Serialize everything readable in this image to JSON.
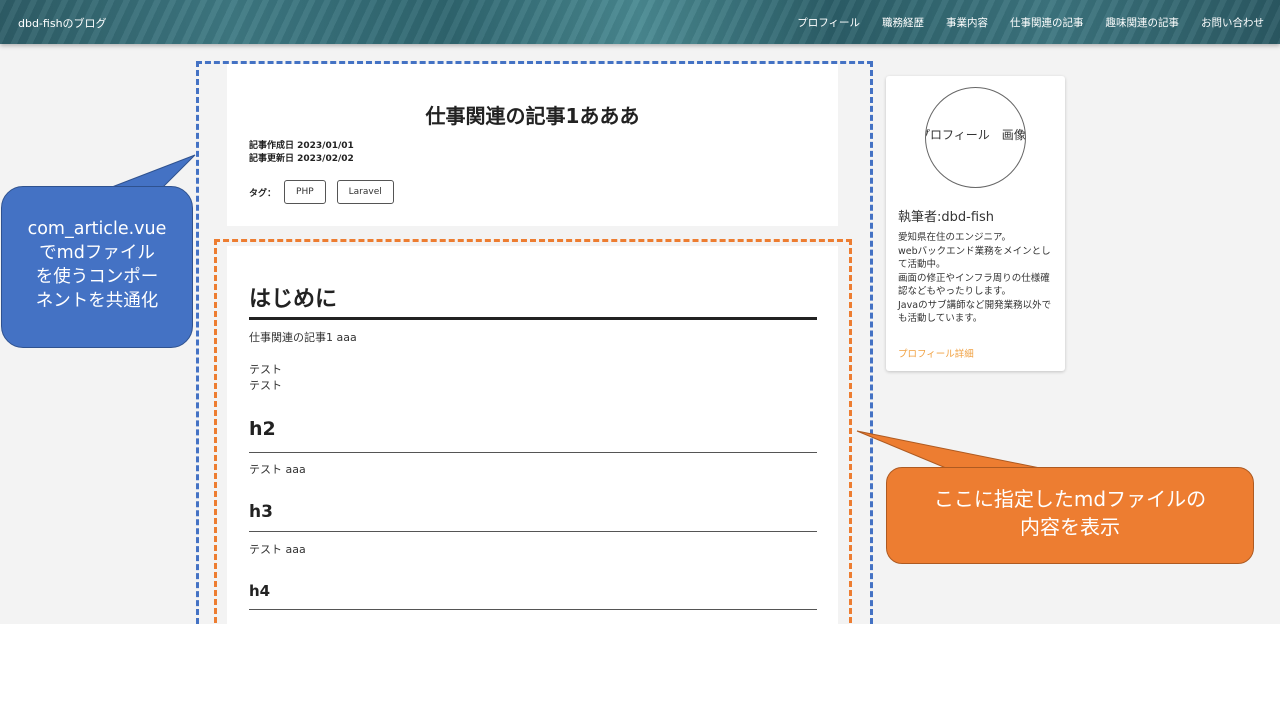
{
  "header": {
    "brand": "dbd-fishのブログ",
    "nav": [
      "プロフィール",
      "職務経歴",
      "事業内容",
      "仕事関連の記事",
      "趣味関連の記事",
      "お問い合わせ"
    ]
  },
  "article": {
    "title": "仕事関連の記事1あああ",
    "created": "記事作成日 2023/01/01",
    "updated": "記事更新日 2023/02/02",
    "tags_label": "タグ：",
    "tags": [
      "PHP",
      "Laravel"
    ]
  },
  "markdown": {
    "h1": "はじめに",
    "p1": "仕事関連の記事1 aaa",
    "p2_line1": "テスト",
    "p2_line2": "テスト",
    "h2": "h2",
    "p3": "テスト aaa",
    "h3": "h3",
    "p4": "テスト aaa",
    "h4": "h4"
  },
  "sidebar": {
    "avatar_alt": "プロフィール　画像",
    "author": "執筆者:dbd-fish",
    "bio": [
      "愛知県在住のエンジニア。",
      "webバックエンド業務をメインとし",
      "て活動中。",
      "画面の修正やインフラ周りの仕様確",
      "認などもやったりします。",
      "Javaのサブ講師など開発業務以外で",
      "も活動しています。"
    ],
    "more_link": "プロフィール詳細"
  },
  "annotations": {
    "blue_lines": [
      "com_article.vue",
      "でmdファイル",
      "を使うコンポー",
      "ネントを共通化"
    ],
    "orange_lines": [
      "ここに指定したmdファイルの",
      "内容を表示"
    ],
    "blue_color": "#4472c4",
    "orange_color": "#ed7d31"
  }
}
